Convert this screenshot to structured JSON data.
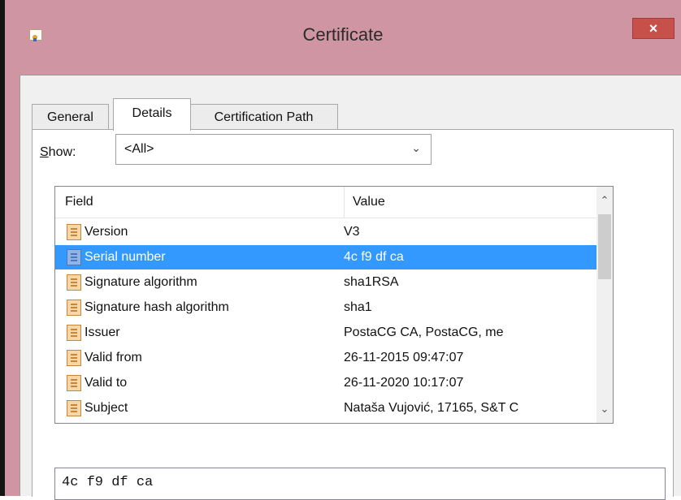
{
  "window": {
    "title": "Certificate",
    "close_label": "×"
  },
  "tabs": [
    {
      "label": "General",
      "active": false
    },
    {
      "label": "Details",
      "active": true
    },
    {
      "label": "Certification Path",
      "active": false
    }
  ],
  "show": {
    "label_first": "S",
    "label_rest": "how:",
    "selected": "<All>"
  },
  "list": {
    "columns": [
      "Field",
      "Value"
    ],
    "rows": [
      {
        "field": "Version",
        "value": "V3"
      },
      {
        "field": "Serial number",
        "value": "4c f9 df ca",
        "selected": true
      },
      {
        "field": "Signature algorithm",
        "value": "sha1RSA"
      },
      {
        "field": "Signature hash algorithm",
        "value": "sha1"
      },
      {
        "field": "Issuer",
        "value": "PostaCG CA, PostaCG, me"
      },
      {
        "field": "Valid from",
        "value": "26-11-2015 09:47:07"
      },
      {
        "field": "Valid to",
        "value": "26-11-2020 10:17:07"
      },
      {
        "field": "Subject",
        "value": "Nataša Vujović, 17165, S&T C"
      }
    ]
  },
  "value_box": {
    "text": "4c f9 df ca"
  },
  "colors": {
    "selection": "#3399ff",
    "title_bar": "#cf95a2",
    "close_button": "#c7504b"
  }
}
